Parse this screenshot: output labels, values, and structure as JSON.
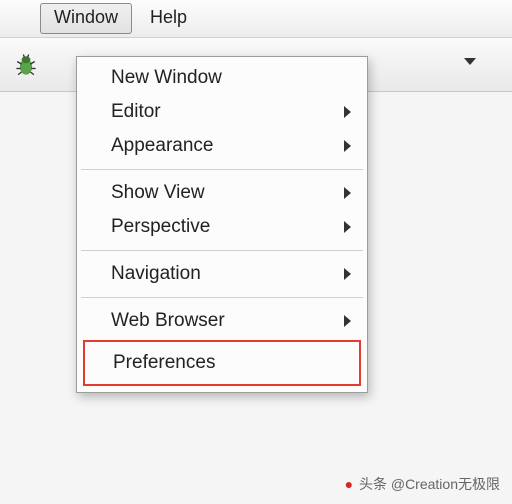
{
  "menubar": {
    "window": "Window",
    "help": "Help"
  },
  "dropdown": {
    "items": [
      {
        "label": "New Window",
        "submenu": false
      },
      {
        "label": "Editor",
        "submenu": true
      },
      {
        "label": "Appearance",
        "submenu": true
      },
      {
        "label": "Show View",
        "submenu": true
      },
      {
        "label": "Perspective",
        "submenu": true
      },
      {
        "label": "Navigation",
        "submenu": true
      },
      {
        "label": "Web Browser",
        "submenu": true
      },
      {
        "label": "Preferences",
        "submenu": false
      }
    ]
  },
  "watermark": "头条 @Creation无极限"
}
